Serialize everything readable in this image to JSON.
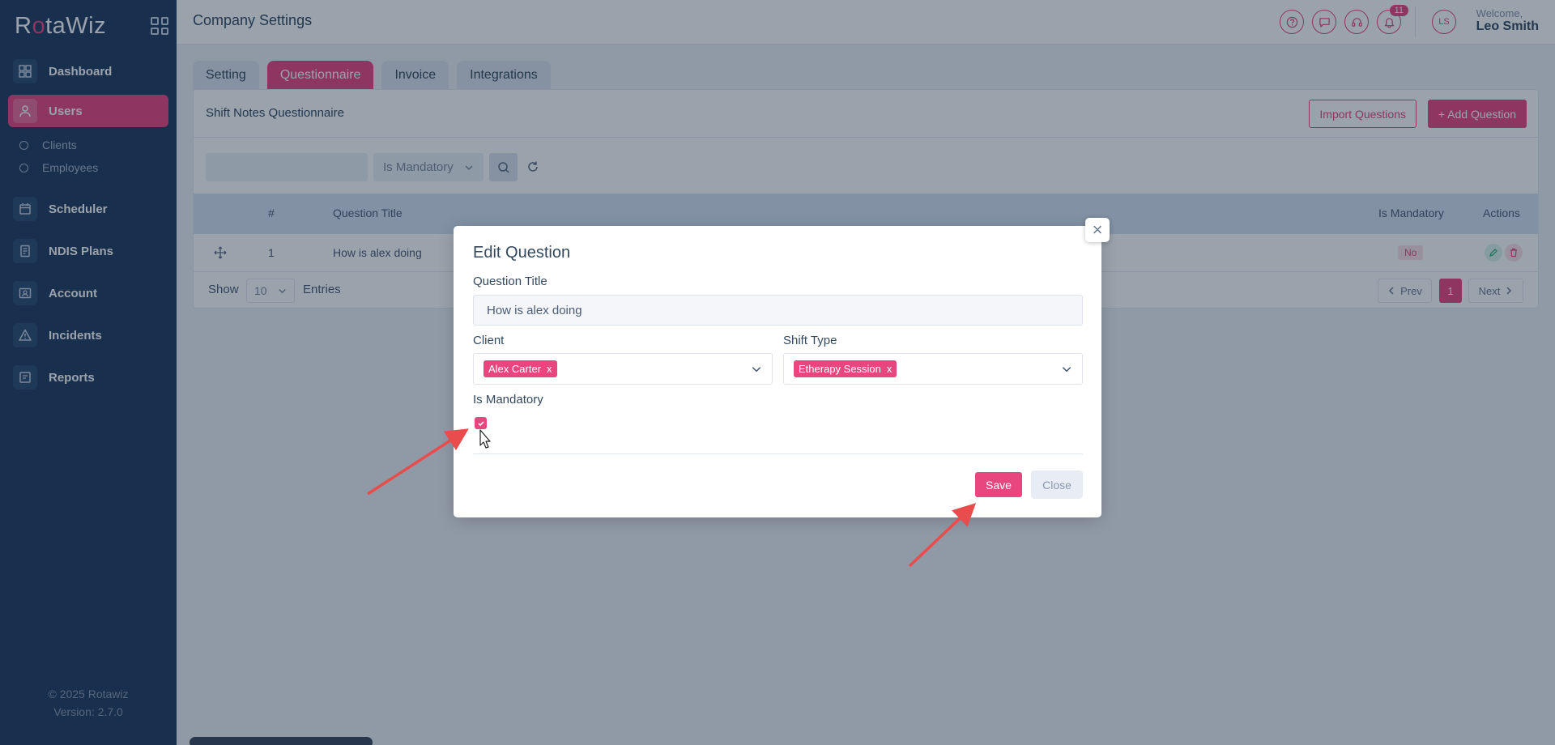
{
  "app": {
    "logo_prefix": "R",
    "logo_accent": "o",
    "logo_suffix": "taWiz",
    "brand_color": "#e8467f",
    "sidebar_color": "#1f3a5c"
  },
  "sidebar": {
    "items": [
      {
        "label": "Dashboard",
        "icon": "grid-icon"
      },
      {
        "label": "Users",
        "icon": "user-icon"
      },
      {
        "label": "Scheduler",
        "icon": "calendar-icon"
      },
      {
        "label": "NDIS Plans",
        "icon": "document-icon"
      },
      {
        "label": "Account",
        "icon": "id-card-icon"
      },
      {
        "label": "Incidents",
        "icon": "warning-icon"
      },
      {
        "label": "Reports",
        "icon": "report-icon"
      }
    ],
    "sub_items": [
      {
        "label": "Clients"
      },
      {
        "label": "Employees"
      }
    ],
    "footer_copyright": "© 2025 Rotawiz",
    "footer_version": "Version: 2.7.0"
  },
  "header": {
    "title": "Company Settings",
    "notification_count": "11",
    "avatar_initials": "LS",
    "welcome": "Welcome,",
    "user_name": "Leo Smith"
  },
  "tabs": [
    {
      "label": "Setting"
    },
    {
      "label": "Questionnaire"
    },
    {
      "label": "Invoice"
    },
    {
      "label": "Integrations"
    }
  ],
  "card": {
    "title": "Shift Notes Questionnaire",
    "import_button": "Import Questions",
    "add_button": "+ Add Question",
    "filter_label": "Is Mandatory",
    "columns": {
      "num": "#",
      "title": "Question Title",
      "mandatory": "Is Mandatory",
      "actions": "Actions"
    },
    "rows": [
      {
        "num": "1",
        "title": "How is alex doing",
        "mandatory": "No"
      }
    ],
    "footer": {
      "show": "Show",
      "page_length": "10",
      "entries": "Entries",
      "prev": "Prev",
      "page": "1",
      "next": "Next"
    }
  },
  "modal": {
    "title": "Edit Question",
    "close_x": "×",
    "question_title_label": "Question Title",
    "question_title_value": "How is alex doing",
    "client_label": "Client",
    "client_tag": "Alex Carter",
    "shift_type_label": "Shift Type",
    "shift_type_tag": "Etherapy Session",
    "tag_remove": "x",
    "mandatory_label": "Is Mandatory",
    "mandatory_checked": true,
    "save_label": "Save",
    "close_label": "Close"
  }
}
